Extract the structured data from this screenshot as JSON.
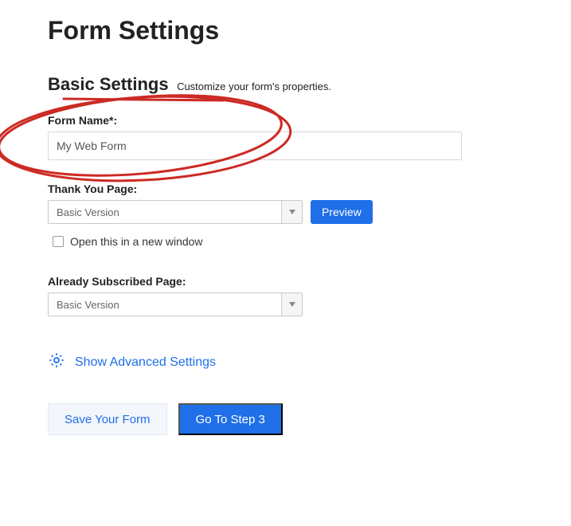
{
  "page": {
    "title": "Form Settings"
  },
  "basic": {
    "heading": "Basic Settings",
    "subtitle": "Customize your form's properties."
  },
  "formName": {
    "label": "Form Name*:",
    "value": "My Web Form"
  },
  "thankYou": {
    "label": "Thank You Page:",
    "selected": "Basic Version",
    "previewLabel": "Preview"
  },
  "newWindow": {
    "label": "Open this in a new window",
    "checked": false
  },
  "alreadySubscribed": {
    "label": "Already Subscribed Page:",
    "selected": "Basic Version"
  },
  "advanced": {
    "toggleLabel": "Show Advanced Settings"
  },
  "actions": {
    "save": "Save Your Form",
    "next": "Go To Step 3"
  }
}
